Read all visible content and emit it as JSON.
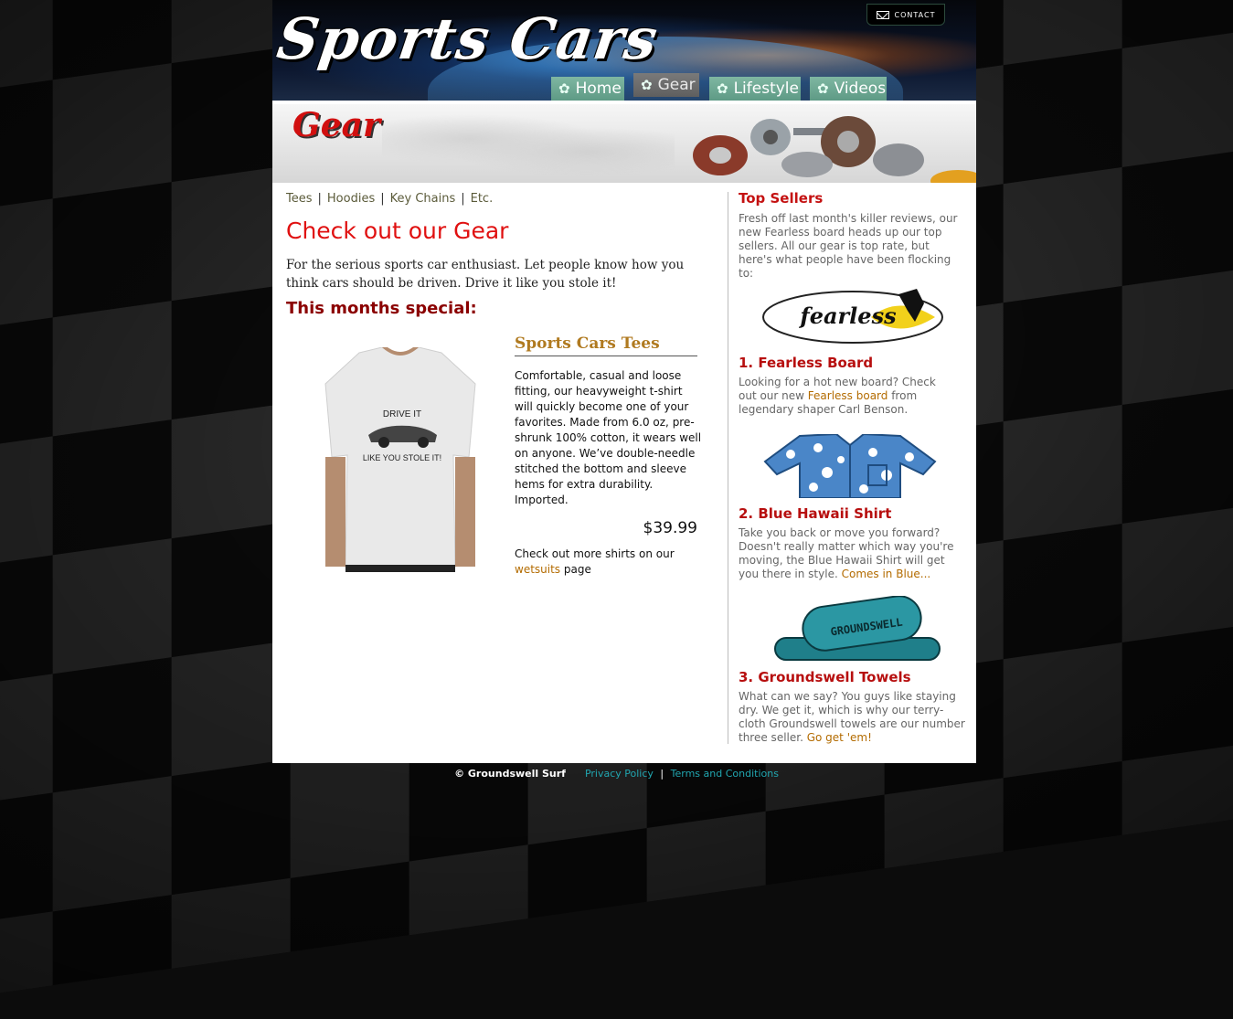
{
  "header": {
    "logo": "Sports Cars",
    "contact_label": "CONTACT",
    "nav": [
      {
        "label": "Home",
        "active": false
      },
      {
        "label": "Gear",
        "active": true
      },
      {
        "label": "Lifestyle",
        "active": false
      },
      {
        "label": "Videos",
        "active": false
      }
    ]
  },
  "banner": {
    "title": "Gear"
  },
  "subnav": {
    "items": [
      "Tees",
      "Hoodies",
      "Key Chains",
      "Etc."
    ],
    "separator": "|"
  },
  "main": {
    "heading": "Check out our Gear",
    "intro": "For the serious sports car enthusiast. Let people know how you think cars should be driven. Drive it like you stole it!",
    "special_heading": "This months special:",
    "tshirt_text_line1": "DRIVE IT",
    "tshirt_text_line2": "LIKE YOU STOLE IT!",
    "product": {
      "title": "Sports Cars Tees",
      "description": "Comfortable, casual and loose fitting, our heavyweight t-shirt will quickly become one of your favorites. Made from 6.0 oz, pre-shrunk 100% cotton, it wears well on anyone. We’ve double-needle stitched the bottom and sleeve hems for extra durability. Imported.",
      "price": "$39.99",
      "more_before": "Check out more shirts on our ",
      "more_link": "wetsuits",
      "more_after": " page"
    }
  },
  "sidebar": {
    "title": "Top Sellers",
    "intro": "Fresh off last month's killer reviews, our new Fearless board heads up our top sellers. All our gear is top rate, but here's what people have been flocking to:",
    "items": [
      {
        "title": "1. Fearless Board",
        "text_before": "Looking for a hot new board? Check out our new ",
        "link": "Fearless board",
        "text_after": " from legendary shaper Carl Benson.",
        "image_text": "fearless"
      },
      {
        "title": "2. Blue Hawaii Shirt",
        "text_before": "Take you back or move you forward? Doesn't really matter which way you're moving, the Blue Hawaii Shirt will get you there in style. ",
        "link": "Comes in Blue...",
        "text_after": ""
      },
      {
        "title": "3. Groundswell Towels",
        "text_before": "What can we say? You guys like staying dry. We get it, which is why our terry-cloth Groundswell towels are our number three seller. ",
        "link": "Go get 'em!",
        "text_after": "",
        "image_text": "GROUNDSWELL"
      }
    ]
  },
  "footer": {
    "copyright": "© Groundswell Surf",
    "privacy": "Privacy Policy",
    "separator": "|",
    "terms": "Terms and Conditions"
  },
  "colors": {
    "accent_red": "#e01010",
    "nav_green": "#6aa88f",
    "link_orange": "#b36b00",
    "footer_link": "#21a6b0"
  },
  "icons": [
    "envelope-icon",
    "hibiscus-flower-icon"
  ]
}
